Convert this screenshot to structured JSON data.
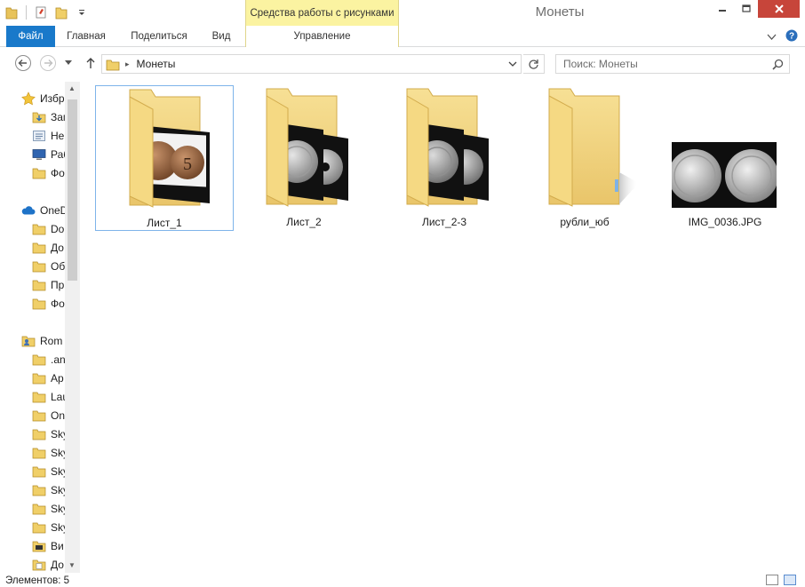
{
  "window": {
    "title": "Монеты",
    "context_tab_group": "Средства работы с рисунками"
  },
  "ribbon": {
    "tabs": [
      {
        "label": "Файл"
      },
      {
        "label": "Главная"
      },
      {
        "label": "Поделиться"
      },
      {
        "label": "Вид"
      },
      {
        "label": "Управление"
      }
    ]
  },
  "address": {
    "breadcrumb": "Монеты",
    "search_placeholder": "Поиск: Монеты"
  },
  "navpane": {
    "items": [
      {
        "label": "Избр",
        "icon": "star-icon"
      },
      {
        "label": "Заг",
        "icon": "downloads-icon"
      },
      {
        "label": "Не",
        "icon": "recent-places-icon"
      },
      {
        "label": "Раб",
        "icon": "desktop-icon"
      },
      {
        "label": "Фо",
        "icon": "folder-icon"
      },
      {
        "label": "OneD",
        "icon": "onedrive-icon"
      },
      {
        "label": "Do",
        "icon": "folder-icon"
      },
      {
        "label": "До",
        "icon": "folder-icon"
      },
      {
        "label": "Об",
        "icon": "folder-icon"
      },
      {
        "label": "Пр",
        "icon": "folder-icon"
      },
      {
        "label": "Фо",
        "icon": "folder-icon"
      },
      {
        "label": "Rom",
        "icon": "user-folder-icon"
      },
      {
        "label": ".an",
        "icon": "folder-icon"
      },
      {
        "label": "Ар",
        "icon": "folder-icon"
      },
      {
        "label": "Lau",
        "icon": "folder-icon"
      },
      {
        "label": "On",
        "icon": "folder-icon"
      },
      {
        "label": "Sky",
        "icon": "folder-icon"
      },
      {
        "label": "Sky",
        "icon": "folder-icon"
      },
      {
        "label": "Sky",
        "icon": "folder-icon"
      },
      {
        "label": "Sky",
        "icon": "folder-icon"
      },
      {
        "label": "Sky",
        "icon": "folder-icon"
      },
      {
        "label": "Sky",
        "icon": "folder-icon"
      },
      {
        "label": "Ви",
        "icon": "video-folder-icon"
      },
      {
        "label": "До",
        "icon": "documents-folder-icon"
      }
    ]
  },
  "files": [
    {
      "name": "Лист_1",
      "kind": "folder-with-photo"
    },
    {
      "name": "Лист_2",
      "kind": "folder-with-photos"
    },
    {
      "name": "Лист_2-3",
      "kind": "folder-with-photos"
    },
    {
      "name": "рубли_юб",
      "kind": "folder"
    },
    {
      "name": "IMG_0036.JPG",
      "kind": "image"
    }
  ],
  "status": {
    "items_count": "Элементов: 5"
  },
  "colors": {
    "file_tab": "#1979ca",
    "context_tab": "#fbf3a1",
    "close_button": "#c7453a",
    "selection_border": "#7eb4ea",
    "folder_yellow": "#f3d57a"
  }
}
